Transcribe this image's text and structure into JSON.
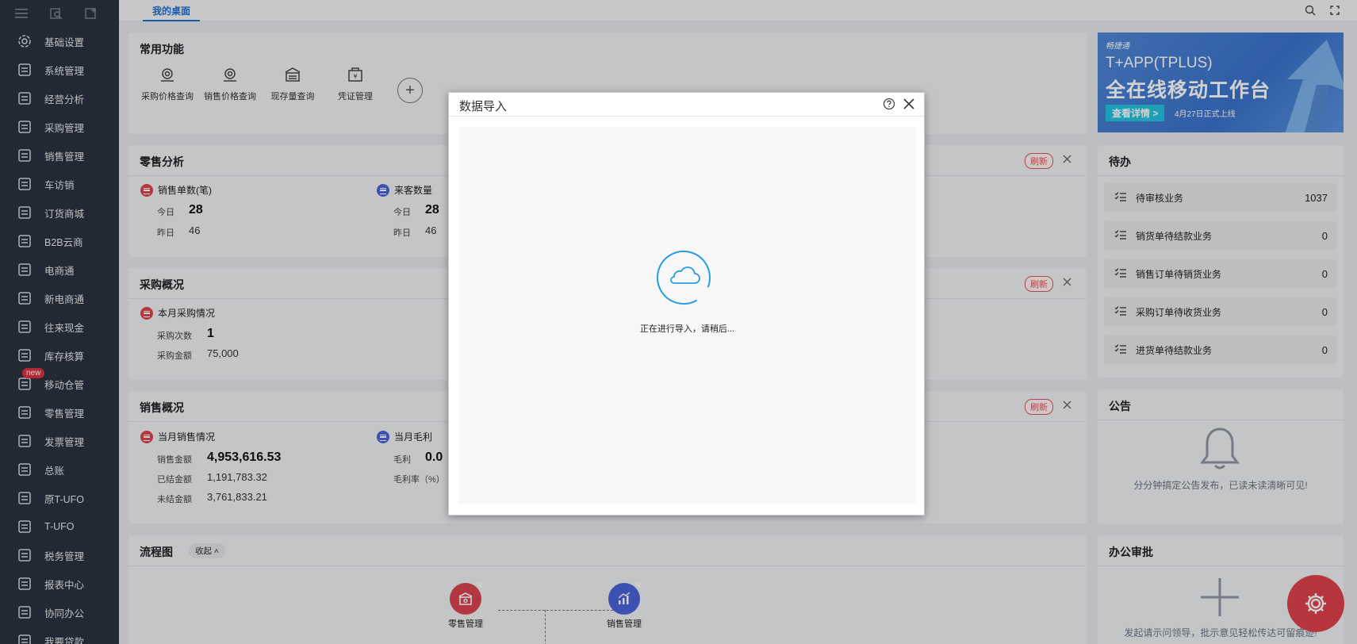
{
  "sidebar": {
    "items": [
      {
        "label": "基础设置",
        "icon": "gear-icon"
      },
      {
        "label": "系统管理",
        "icon": "code-monitor-icon"
      },
      {
        "label": "经营分析",
        "icon": "chart-monitor-icon"
      },
      {
        "label": "采购管理",
        "icon": "cart-icon"
      },
      {
        "label": "销售管理",
        "icon": "trend-up-icon"
      },
      {
        "label": "车访销",
        "icon": "grid-plus-icon"
      },
      {
        "label": "订货商城",
        "icon": "store-icon"
      },
      {
        "label": "B2B云商",
        "icon": "bag-icon"
      },
      {
        "label": "电商通",
        "icon": "circle-dian-icon"
      },
      {
        "label": "新电商通",
        "icon": "circle-e-icon"
      },
      {
        "label": "往来现金",
        "icon": "exchange-icon"
      },
      {
        "label": "库存核算",
        "icon": "warehouse-icon"
      },
      {
        "label": "移动仓管",
        "icon": "mobile-warehouse-icon",
        "badge": "new"
      },
      {
        "label": "零售管理",
        "icon": "retail-icon"
      },
      {
        "label": "发票管理",
        "icon": "invoice-icon"
      },
      {
        "label": "总账",
        "icon": "ledger-icon"
      },
      {
        "label": "原T-UFO",
        "icon": "ufo-icon"
      },
      {
        "label": "T-UFO",
        "icon": "building-icon"
      },
      {
        "label": "税务管理",
        "icon": "tax-icon"
      },
      {
        "label": "报表中心",
        "icon": "pie-icon"
      },
      {
        "label": "协同办公",
        "icon": "cooperate-icon"
      },
      {
        "label": "我要贷款",
        "icon": "loan-icon"
      }
    ]
  },
  "topbar": {
    "tab_label": "我的桌面"
  },
  "common": {
    "title": "常用功能",
    "items": [
      {
        "label": "采购价格查询"
      },
      {
        "label": "销售价格查询"
      },
      {
        "label": "现存量查询"
      },
      {
        "label": "凭证管理"
      }
    ],
    "add_label": "+"
  },
  "retail": {
    "title": "零售分析",
    "refresh": "刷新",
    "left": {
      "head": "销售单数(笔)",
      "today_label": "今日",
      "today_value": "28",
      "yesterday_label": "昨日",
      "yesterday_value": "46"
    },
    "right": {
      "head": "来客数量",
      "today_label": "今日",
      "today_value": "28",
      "yesterday_label": "昨日",
      "yesterday_value": "46"
    }
  },
  "purchase": {
    "title": "采购概况",
    "refresh": "刷新",
    "head": "本月采购情况",
    "count_label": "采购次数",
    "count_value": "1",
    "amount_label": "采购金额",
    "amount_value": "75,000"
  },
  "sales": {
    "title": "销售概况",
    "refresh": "刷新",
    "left": {
      "head": "当月销售情况",
      "amount_label": "销售金额",
      "amount_value": "4,953,616.53",
      "settled_label": "已结金额",
      "settled_value": "1,191,783.32",
      "unsettled_label": "未结金额",
      "unsettled_value": "3,761,833.21"
    },
    "right": {
      "head": "当月毛利",
      "gross_label": "毛利",
      "gross_value": "0.0",
      "rate_label": "毛利率（%）"
    }
  },
  "flow": {
    "title": "流程图",
    "collapse": "收起 ˄",
    "nodes": [
      {
        "label": "零售管理",
        "color": "#d9444f"
      },
      {
        "label": "销售管理",
        "color": "#4a63d8"
      }
    ]
  },
  "banner": {
    "brand": "畅捷通",
    "line1": "T+APP(TPLUS)",
    "line2": "全在线移动工作台",
    "button": "查看详情 >",
    "date": "4月27日正式上线"
  },
  "todo": {
    "title": "待办",
    "items": [
      {
        "label": "待审核业务",
        "count": "1037"
      },
      {
        "label": "销货单待结款业务",
        "count": "0"
      },
      {
        "label": "销售订单待销货业务",
        "count": "0"
      },
      {
        "label": "采购订单待收货业务",
        "count": "0"
      },
      {
        "label": "进货单待结款业务",
        "count": "0"
      }
    ]
  },
  "notice": {
    "title": "公告",
    "empty_text": "分分钟搞定公告发布，已读未读清晰可见!"
  },
  "approval": {
    "title": "办公审批",
    "empty_text": "发起请示问领导，批示意见轻松传达可留痕迹!"
  },
  "modal": {
    "title": "数据导入",
    "status": "正在进行导入，请稍后..."
  },
  "colors": {
    "sidebar_bg": "#2b3340",
    "accent": "#1f6fd6",
    "danger": "#d9444f",
    "loader": "#2a9de0"
  }
}
